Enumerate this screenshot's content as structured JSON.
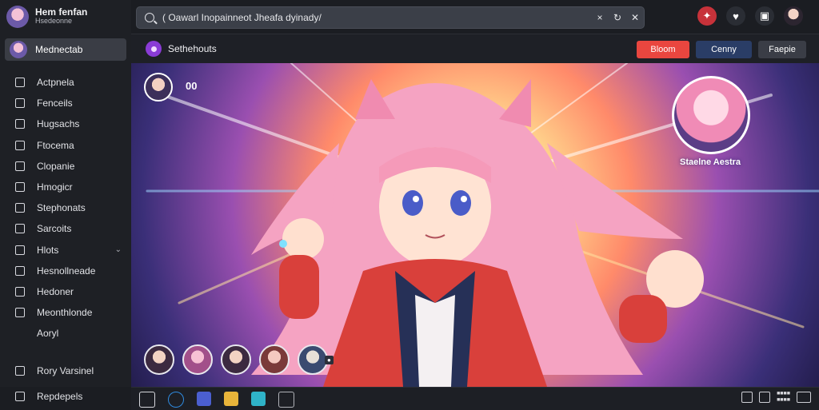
{
  "profile": {
    "name": "Hem fenfan",
    "sub": "Hsedeonne"
  },
  "active_item": {
    "label": "Mednectab"
  },
  "nav": [
    {
      "label": "Actpnela",
      "icon": "book-icon"
    },
    {
      "label": "Fenceils",
      "icon": "pin-icon"
    },
    {
      "label": "Hugsachs",
      "icon": "list-icon"
    },
    {
      "label": "Ftocema",
      "icon": "image-icon"
    },
    {
      "label": "Clopanie",
      "icon": "grid-icon"
    },
    {
      "label": "Hmogicr",
      "icon": "bookmark-icon"
    },
    {
      "label": "Stephonats",
      "icon": "folder-icon"
    },
    {
      "label": "Sarcoits",
      "icon": "clock-icon"
    },
    {
      "label": "Hlots",
      "icon": "square-icon",
      "chevron": "⌄"
    },
    {
      "label": "Hesnollneade",
      "icon": "terminal-icon"
    },
    {
      "label": "Hedoner",
      "icon": "document-icon"
    },
    {
      "label": "Meonthlonde",
      "icon": "pen-icon"
    },
    {
      "label": "Aoryl",
      "icon": ""
    }
  ],
  "nav_bottom": [
    {
      "label": "Rory Varsinel",
      "icon": "heart-icon"
    },
    {
      "label": "Repdepels",
      "icon": "gear-icon"
    }
  ],
  "search": {
    "value": "( Oawarl Inopainneot Jheafa dyinady/",
    "clear": "×",
    "refresh": "↻",
    "close": "✕"
  },
  "channel": {
    "name": "Sethehouts"
  },
  "buttons": {
    "follow": "Bloom",
    "subscribe": "Cenny",
    "share": "Faepie"
  },
  "stage": {
    "viewer_count": "00",
    "featured_caption": "Staelne Aestra"
  },
  "chat_tag": "●",
  "colors": {
    "accent_red": "#e9463f",
    "accent_blue": "#2a3d66",
    "sidebar_bg": "#1e2025",
    "channel_purple": "#8a3bd6"
  }
}
